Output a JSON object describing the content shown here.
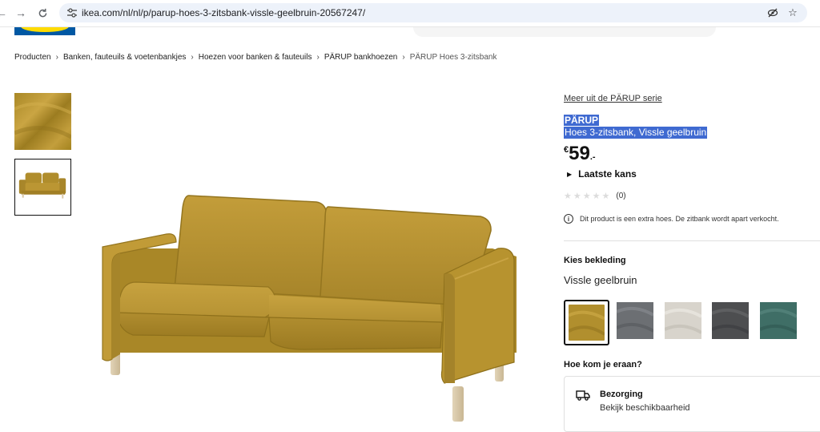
{
  "browser": {
    "url": "ikea.com/nl/nl/p/parup-hoes-3-zitsbank-vissle-geelbruin-20567247/",
    "back_icon": "arrow-left-icon",
    "forward_icon": "arrow-right-icon",
    "reload_icon": "reload-icon"
  },
  "breadcrumb": [
    "Producten",
    "Banken, fauteuils & voetenbankjes",
    "Hoezen voor banken & fauteuils",
    "PÄRUP bankhoezen",
    "PÄRUP Hoes 3-zitsbank"
  ],
  "product": {
    "series_link": "Meer uit de PÄRUP serie",
    "name": "PÄRUP",
    "description": "Hoes 3-zitsbank, Vissle geelbruin",
    "price_currency": "€",
    "price_int": "59",
    "price_dec": ".-",
    "last_chance": "Laatste kans",
    "rating_stars": 0,
    "rating_count": "(0)",
    "info_text": "Dit product is een extra hoes. De zitbank wordt apart verkocht.",
    "choose_label": "Kies bekleding",
    "choose_value": "Vissle geelbruin",
    "how_label": "Hoe kom je eraan?",
    "delivery_title": "Bezorging",
    "delivery_sub": "Bekijk beschikbaarheid"
  },
  "swatches": [
    {
      "name": "Vissle geelbruin",
      "color": "#b18f2e",
      "selected": true
    },
    {
      "name": "grijs",
      "color": "#6c6f73"
    },
    {
      "name": "beige",
      "color": "#d8d4cc"
    },
    {
      "name": "donkergrijs",
      "color": "#4d4e50"
    },
    {
      "name": "groen",
      "color": "#3f6e66"
    }
  ],
  "colors": {
    "sofa": "#b8932f",
    "highlight": "#3f6ad1"
  }
}
